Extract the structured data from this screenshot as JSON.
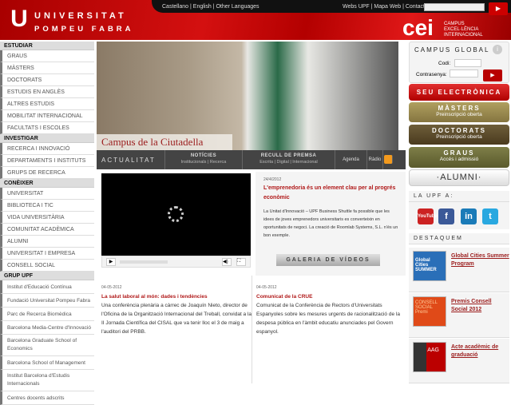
{
  "header": {
    "logo_line1": "UNIVERSITAT",
    "logo_line2": "POMPEU FABRA",
    "lang_links": "Castellano | English | Other Languages",
    "util_links": "Webs UPF | Mapa Web | Contacte",
    "search_value": "",
    "search_icon": "play-arrow",
    "cei": "cei",
    "cei_sub": [
      "CAMPUS",
      "EXCEL·LÈNCIA",
      "INTERNACIONAL"
    ]
  },
  "sidebar": {
    "sections": [
      {
        "title": "ESTUDIAR",
        "items": [
          "GRAUS",
          "MÀSTERS",
          "DOCTORATS",
          "ESTUDIS EN ANGLÈS",
          "ALTRES ESTUDIS",
          "MOBILITAT INTERNACIONAL",
          "FACULTATS I ESCOLES"
        ]
      },
      {
        "title": "INVESTIGAR",
        "items": [
          "RECERCA I INNOVACIÓ",
          "DEPARTAMENTS I INSTITUTS",
          "GRUPS DE RECERCA"
        ]
      },
      {
        "title": "CONÈIXER",
        "items": [
          "UNIVERSITAT",
          "BIBLIOTECA I TIC",
          "VIDA UNIVERSITÀRIA",
          "COMUNITAT ACADÈMICA",
          "ALUMNI",
          "UNIVERSITAT I EMPRESA",
          "CONSELL SOCIAL"
        ]
      },
      {
        "title": "GRUP UPF",
        "items": [
          "Institut d'Educació Contínua",
          "Fundació Universitat Pompeu Fabra",
          "Parc de Recerca Biomèdica",
          "Barcelona Media-Centre d'Innovació",
          "Barcelona Graduate School of Economics",
          "Barcelona School of Management",
          "Institut Barcelona d'Estudis Internacionals",
          "Centres docents adscrits"
        ]
      }
    ]
  },
  "hero": {
    "caption": "Campus de la Ciutadella"
  },
  "nav": {
    "title": "ACTUALITAT",
    "noticies": "NOTÍCIES",
    "noticies_sub": "Institucionals | Recerca",
    "premsa": "RECULL DE PREMSA",
    "premsa_sub": "Escrita | Digital | Internacional",
    "agenda": "Agenda",
    "radio": "Ràdio",
    "rss_icon": "rss"
  },
  "video_article": {
    "date": "24/4/2012",
    "title": "L'emprenedoria és un element clau per al progrés econòmic",
    "body": "La Unitat d'Innovació – UPF Business Shuttle fa possible que les idees de joves emprenedors universitaris es converteixin en oportunitats de negoci. La creació de Roomlab Systems, S.L. n'és un bon exemple.",
    "gallery_button": "GALERIA DE VÍDEOS"
  },
  "articles": [
    {
      "date": "04-05-2012",
      "title": "La salut laboral al món: dades i tendències",
      "body": "Una conferència plenària a càrrec de Joaquín Nieto, director de l'Oficina de la Organització Internacional del Treball, convidat a la II Jornada Científica del CISAL que va tenir lloc el 3 de maig a l'auditori del PRBB."
    },
    {
      "date": "04-05-2012",
      "title": "Comunicat de la CRUE",
      "body": "Comunicat de la Conferència de Rectors d'Universitats Espanyoles sobre les mesures urgents de racionalització de la despesa pública en l'àmbit educatiu anunciades pel Govern espanyol."
    }
  ],
  "right": {
    "campus_title": "CAMPUS GLOBAL",
    "code_label": "Codi:",
    "pass_label": "Contrasenya:",
    "seu": "SEU ELECTRÒNICA",
    "masters": "MÀSTERS",
    "masters_sub": "Preinscripció oberta",
    "doctorats": "DOCTORATS",
    "doctorats_sub": "Preinscripció oberta",
    "graus": "GRAUS",
    "graus_sub": "Accés i admissió",
    "alumni": "·ALUMNI·",
    "social_title": "LA UPF A:",
    "social": [
      "YouTube",
      "f",
      "in",
      "t"
    ],
    "destaquem_title": "DESTAQUEM",
    "destaquem": [
      {
        "label": "Global Cities Summer Program",
        "img": "Global Cities SUMMER"
      },
      {
        "label": "Premis Consell Social 2012",
        "img": "CONSELL SOCIAL Premi"
      },
      {
        "label": "Acte acadèmic de graduació",
        "img": "AAG"
      }
    ]
  },
  "colors": {
    "brand_red": "#c8102e",
    "masters": "#9a8a50",
    "doctorats": "#5a4a2a",
    "graus": "#6e6e3a"
  }
}
